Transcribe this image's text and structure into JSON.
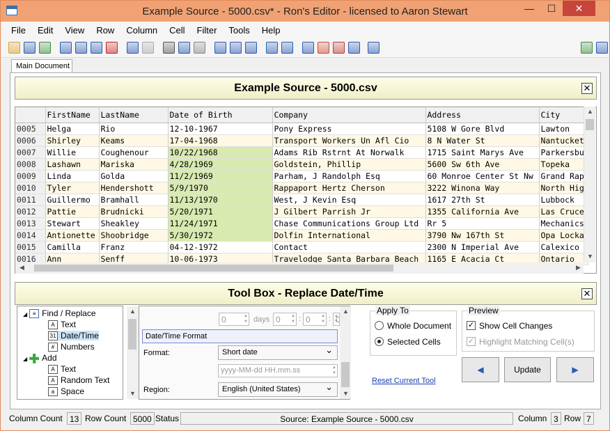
{
  "window": {
    "title": "Example Source - 5000.csv* - Ron's Editor - licensed to Aaron Stewart",
    "min": "—",
    "max": "☐",
    "close": "✕"
  },
  "menu": [
    "File",
    "Edit",
    "View",
    "Row",
    "Column",
    "Cell",
    "Filter",
    "Tools",
    "Help"
  ],
  "toolbar": {
    "colors": [
      "#d9a531",
      "#2a5bb5",
      "#3b8f3b",
      "#2a5bb5",
      "#2a5bb5",
      "#2a5bb5",
      "#cc2222",
      "#2a5bb5",
      "#aaaaaa",
      "#555555",
      "#2a5bb5",
      "#888888",
      "#2a5bb5",
      "#2a5bb5",
      "#2a5bb5",
      "#2a5bb5",
      "#2a5bb5",
      "#2a5bb5",
      "#d24b2e",
      "#c23a3a",
      "#2a5bb5",
      "#2a5bb5",
      "#3b8f3b",
      "#2a5bb5"
    ]
  },
  "tab": {
    "label": "Main Document"
  },
  "document": {
    "title": "Example Source - 5000.csv",
    "close": "✕"
  },
  "grid": {
    "columns": [
      "",
      "FirstName",
      "LastName",
      "Date of Birth",
      "Company",
      "Address",
      "City"
    ],
    "rows": [
      {
        "n": "0005",
        "first": "Helga",
        "last": "Rio",
        "dob": "12-10-1967",
        "company": "Pony Express",
        "address": "5108 W Gore Blvd",
        "city": "Lawton",
        "hl": false
      },
      {
        "n": "0006",
        "first": "Shirley",
        "last": "Keams",
        "dob": "17-04-1968",
        "company": "Transport Workers Un Afl Cio",
        "address": "8 N Water St",
        "city": "Nantucket",
        "hl": false
      },
      {
        "n": "0007",
        "first": "Willie",
        "last": "Coughenour",
        "dob": "10/22/1968",
        "company": "Adams Rib Rstrnt At Norwalk",
        "address": "1715 Saint Marys Ave",
        "city": "Parkersbu",
        "hl": true
      },
      {
        "n": "0008",
        "first": "Lashawn",
        "last": "Mariska",
        "dob": "4/28/1969",
        "company": "Goldstein, Phillip",
        "address": "5600 Sw 6th Ave",
        "city": "Topeka",
        "hl": true
      },
      {
        "n": "0009",
        "first": "Linda",
        "last": "Golda",
        "dob": "11/2/1969",
        "company": "Parham, J Randolph Esq",
        "address": "60 Monroe Center St Nw",
        "city": "Grand Rap",
        "hl": true
      },
      {
        "n": "0010",
        "first": "Tyler",
        "last": "Hendershott",
        "dob": "5/9/1970",
        "company": "Rappaport Hertz Cherson",
        "address": "3222 Winona Way",
        "city": "North Hig",
        "hl": true
      },
      {
        "n": "0011",
        "first": "Guillermo",
        "last": "Bramhall",
        "dob": "11/13/1970",
        "company": "West, J Kevin Esq",
        "address": "1617 27th St",
        "city": "Lubbock",
        "hl": true
      },
      {
        "n": "0012",
        "first": "Pattie",
        "last": "Brudnicki",
        "dob": "5/20/1971",
        "company": "J Gilbert Parrish Jr",
        "address": "1355 California Ave",
        "city": "Las Cruce",
        "hl": true
      },
      {
        "n": "0013",
        "first": "Stewart",
        "last": "Sheakley",
        "dob": "11/24/1971",
        "company": "Chase Communications Group Ltd",
        "address": "Rr 5",
        "city": "Mechanics",
        "hl": true
      },
      {
        "n": "0014",
        "first": "Antionette",
        "last": "Shoobridge",
        "dob": "5/30/1972",
        "company": "Dolfin International",
        "address": "3790 Nw 167th St",
        "city": "Opa Locka",
        "hl": true
      },
      {
        "n": "0015",
        "first": "Camilla",
        "last": "Franz",
        "dob": "04-12-1972",
        "company": "Contact",
        "address": "2300 N Imperial Ave",
        "city": "Calexico",
        "hl": false
      },
      {
        "n": "0016",
        "first": "Ann",
        "last": "Senff",
        "dob": "10-06-1973",
        "company": "Travelodge Santa Barbara Beach",
        "address": "1165 E Acacia Ct",
        "city": "Ontario",
        "hl": false
      }
    ]
  },
  "toolbox": {
    "title": "Tool Box - Replace Date/Time",
    "close": "✕",
    "tree": [
      {
        "label": "Find / Replace",
        "icon": "find-replace-icon"
      },
      {
        "label": "Text",
        "icon": "text-icon"
      },
      {
        "label": "Date/Time",
        "icon": "calendar-icon"
      },
      {
        "label": "Numbers",
        "icon": "numbers-icon"
      },
      {
        "label": "Add",
        "icon": "add-icon"
      },
      {
        "label": "Text",
        "icon": "text-icon"
      },
      {
        "label": "Random Text",
        "icon": "random-text-icon"
      },
      {
        "label": "Space",
        "icon": "space-icon"
      }
    ],
    "options": {
      "days_value": "0",
      "days_label": "days",
      "h": "0",
      "m": "0",
      "s": "0",
      "colon": ":",
      "section": "Date/Time Format",
      "format_label": "Format:",
      "format_value": "Short date",
      "pattern_placeholder": "yyyy-MM-dd HH.mm.ss",
      "region_label": "Region:",
      "region_value": "English (United States)"
    },
    "apply_to": {
      "label": "Apply To",
      "whole": "Whole Document",
      "selected": "Selected Cells"
    },
    "preview": {
      "label": "Preview",
      "show": "Show Cell Changes",
      "highlight": "Highlight Matching Cell(s)"
    },
    "reset": "Reset Current Tool",
    "buttons": {
      "prev": "◀",
      "update": "Update",
      "next": "▶"
    }
  },
  "status": {
    "col_count_label": "Column Count",
    "col_count": "13",
    "row_count_label": "Row Count",
    "row_count": "5000",
    "status_label": "Status",
    "source": "Source: Example Source - 5000.csv",
    "column_label": "Column",
    "column": "3",
    "row_label": "Row",
    "row": "7"
  }
}
